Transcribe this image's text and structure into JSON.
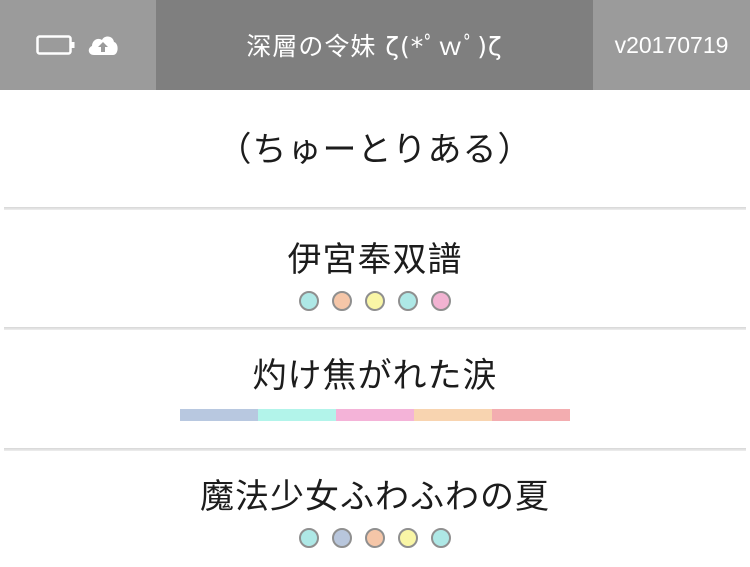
{
  "header": {
    "title": "深層の令妹 ζ(*ﾟｗﾟ)ζ",
    "version": "v20170719",
    "icons": [
      "battery-icon",
      "cloud-upload-icon"
    ]
  },
  "songs": [
    {
      "title": "（ちゅーとりある）"
    },
    {
      "title": "伊宮奉双譜",
      "dots": [
        "#aee8e6",
        "#f5c6a8",
        "#f9f6a6",
        "#aee8e6",
        "#f2b3d2"
      ]
    },
    {
      "title": "灼け焦がれた涙",
      "bar": [
        "#b8c8e0",
        "#b2f4ea",
        "#f4b3d8",
        "#f8d4b0",
        "#f3adb0"
      ]
    },
    {
      "title": "魔法少女ふわふわの夏",
      "dots": [
        "#aee8e6",
        "#b8c6dc",
        "#f5c6a8",
        "#f9f6a6",
        "#aee8e6"
      ]
    }
  ]
}
